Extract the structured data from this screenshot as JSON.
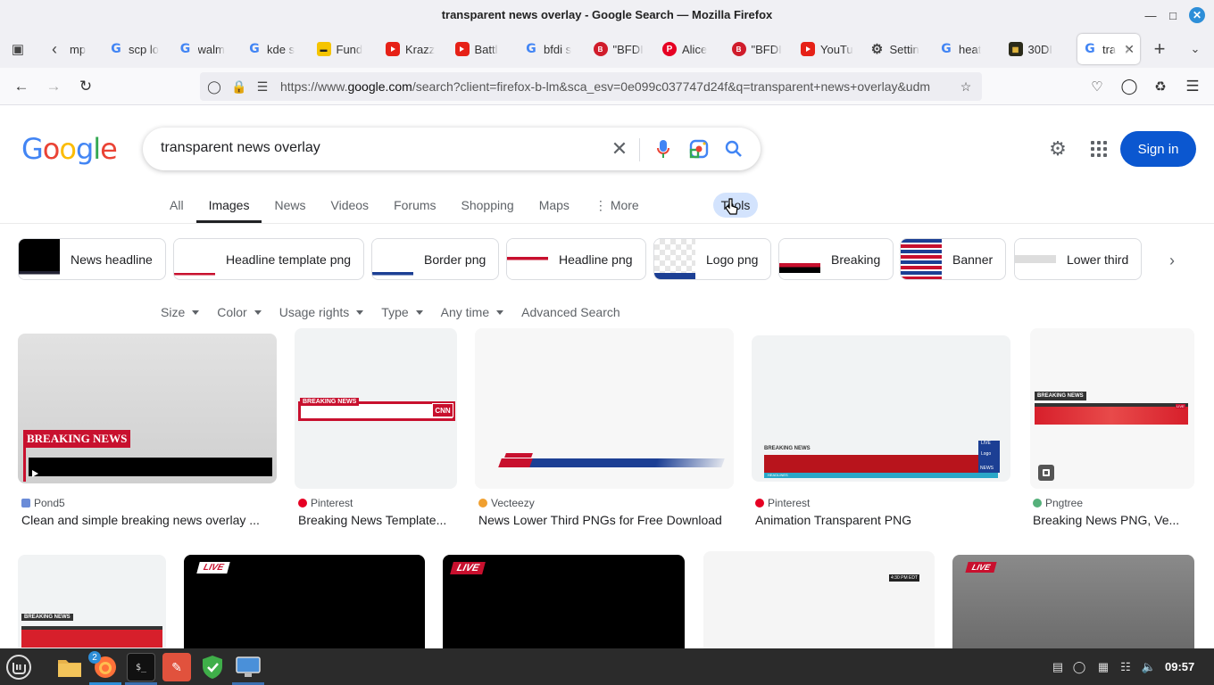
{
  "window": {
    "title": "transparent news overlay - Google Search — Mozilla Firefox"
  },
  "tabs": [
    {
      "favicon": "google",
      "label": "mp"
    },
    {
      "favicon": "google",
      "label": "scp lo"
    },
    {
      "favicon": "google",
      "label": "walm"
    },
    {
      "favicon": "google",
      "label": "kde s"
    },
    {
      "favicon": "fund",
      "label": "Fund"
    },
    {
      "favicon": "youtube",
      "label": "Krazz"
    },
    {
      "favicon": "youtube",
      "label": "Battl"
    },
    {
      "favicon": "google",
      "label": "bfdi s"
    },
    {
      "favicon": "bfdi",
      "label": "\"BFDI"
    },
    {
      "favicon": "pinterest",
      "label": "Alice"
    },
    {
      "favicon": "bfdi",
      "label": "\"BFDI"
    },
    {
      "favicon": "youtube",
      "label": "YouTu"
    },
    {
      "favicon": "gear",
      "label": "Settin"
    },
    {
      "favicon": "google",
      "label": "heat"
    },
    {
      "favicon": "dark",
      "label": "30DI"
    },
    {
      "favicon": "google",
      "label": "tra",
      "active": true
    }
  ],
  "navbar": {
    "url_prefix": "https://www.",
    "url_domain": "google.com",
    "url_rest": "/search?client=firefox-b-lm&sca_esv=0e099c037747d24f&q=transparent+news+overlay&udm"
  },
  "google": {
    "logo_letters": [
      "G",
      "o",
      "o",
      "g",
      "l",
      "e"
    ],
    "logo_colors": [
      "#4285f4",
      "#ea4335",
      "#fbbc05",
      "#4285f4",
      "#34a853",
      "#ea4335"
    ],
    "query": "transparent news overlay",
    "signin_label": "Sign in"
  },
  "search_tabs": [
    {
      "label": "All"
    },
    {
      "label": "Images",
      "active": true
    },
    {
      "label": "News"
    },
    {
      "label": "Videos"
    },
    {
      "label": "Forums"
    },
    {
      "label": "Shopping"
    },
    {
      "label": "Maps"
    },
    {
      "label": "More"
    }
  ],
  "tools_label": "Tools",
  "chips": [
    {
      "label": "News headline"
    },
    {
      "label": "Headline template png"
    },
    {
      "label": "Border png"
    },
    {
      "label": "Headline png"
    },
    {
      "label": "Logo png"
    },
    {
      "label": "Breaking"
    },
    {
      "label": "Banner"
    },
    {
      "label": "Lower third"
    }
  ],
  "filters": [
    {
      "label": "Size"
    },
    {
      "label": "Color"
    },
    {
      "label": "Usage rights"
    },
    {
      "label": "Type"
    },
    {
      "label": "Any time"
    },
    {
      "label": "Advanced Search",
      "no_caret": true
    }
  ],
  "results_row1": [
    {
      "source": "Pond5",
      "title": "Clean and simple breaking news overlay ...",
      "image_text": "BREAKING NEWS"
    },
    {
      "source": "Pinterest",
      "title": "Breaking News Template...",
      "image_text": "BREAKING NEWS",
      "image_logo": "CNN"
    },
    {
      "source": "Vecteezy",
      "title": "News Lower Third PNGs for Free Download"
    },
    {
      "source": "Pinterest",
      "title": "Animation Transparent PNG",
      "image_text": "BREAKING NEWS",
      "image_extra": [
        "LIVE",
        "Logo",
        "NEWS",
        "HEADLINES"
      ]
    },
    {
      "source": "Pngtree",
      "title": "Breaking News PNG, Ve...",
      "image_text": "BREAKING NEWS",
      "image_extra": [
        "LIVE"
      ]
    }
  ],
  "results_row2": [
    {
      "image_text": "BREAKING NEWS"
    },
    {
      "image_text": "LIVE"
    },
    {
      "image_text": "LIVE"
    },
    {
      "image_text": "4:30 PM EDT"
    },
    {
      "image_text": "LIVE"
    }
  ],
  "taskbar": {
    "time": "09:57",
    "firefox_badge": "2"
  },
  "colors": {
    "accent": "#0b57d0",
    "breaking_red": "#c8102e",
    "tools_bg": "#d3e3fd"
  }
}
